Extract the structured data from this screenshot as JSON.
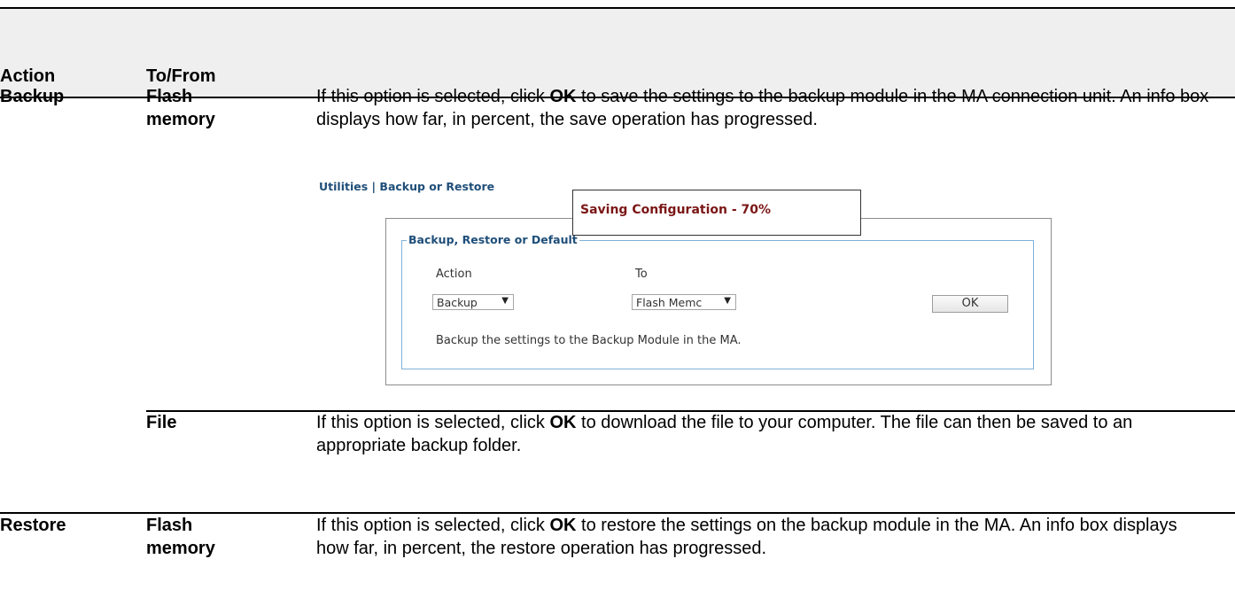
{
  "table": {
    "headers": {
      "action": "Action",
      "tofrom": "To/From"
    },
    "rows": [
      {
        "action": "Backup",
        "tofrom_line1": "Flash",
        "tofrom_line2": "memory",
        "desc_pre": "If this option is selected, click ",
        "desc_bold": "OK",
        "desc_post": " to save the settings to the backup module in the MA connection unit. An info box displays how far, in percent, the save operation has progressed."
      },
      {
        "action": "",
        "tofrom_line1": "File",
        "desc_pre": "If this option is selected, click ",
        "desc_bold": "OK",
        "desc_post": " to download the file to your computer. The file can then be saved to an appropriate backup folder."
      },
      {
        "action": "Restore",
        "tofrom_line1": "Flash",
        "tofrom_line2": "memory",
        "desc_pre": "If this option is selected, click ",
        "desc_bold": "OK",
        "desc_post": " to restore the settings on the backup module in the MA. An info box displays how far, in percent, the restore operation has progressed."
      }
    ]
  },
  "screenshot": {
    "breadcrumb": "Utilities | Backup or Restore",
    "popup": {
      "text": "Saving Configuration - 70%",
      "progress_percent": 70
    },
    "fieldset_legend": "Backup, Restore or Default",
    "action_label": "Action",
    "to_label": "To",
    "action_select": {
      "value": "Backup",
      "arrow": "▼"
    },
    "to_select": {
      "value": "Flash Memc",
      "arrow": "▼"
    },
    "ok_button": "OK",
    "note": "Backup the settings to the Backup Module in the MA."
  },
  "colors": {
    "header_band": "#efefef",
    "breadcrumb": "#1f4e79",
    "popup_text": "#7b1616",
    "fieldset_border": "#7fb1d8"
  }
}
